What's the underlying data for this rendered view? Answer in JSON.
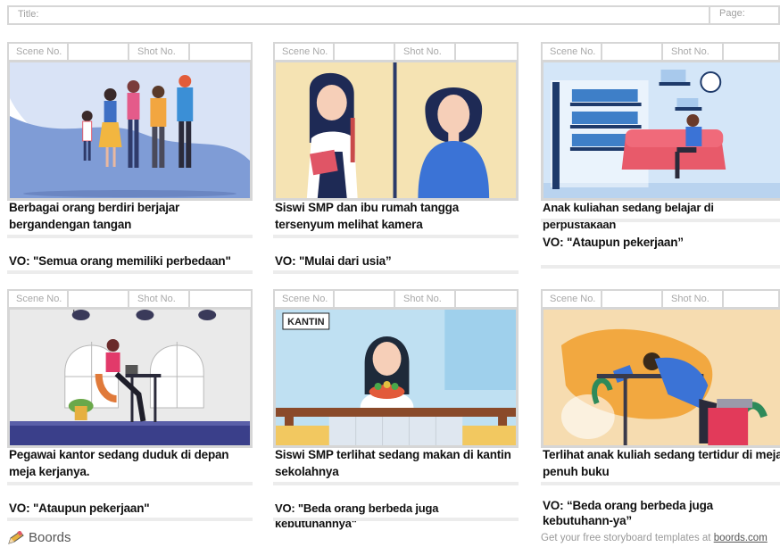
{
  "header": {
    "title_label": "Title:",
    "page_label": "Page:"
  },
  "panels": [
    {
      "scene_label": "Scene No.",
      "shot_label": "Shot No.",
      "description": "Berbagai orang berdiri berjajar bergandengan tangan",
      "vo": "VO: \"Semua orang memiliki perbedaan\""
    },
    {
      "scene_label": "Scene No.",
      "shot_label": "Shot No.",
      "description": "Siswi SMP dan ibu rumah tangga tersenyum melihat kamera",
      "vo": "VO: \"Mulai dari usia”"
    },
    {
      "scene_label": "Scene No.",
      "shot_label": "Shot No.",
      "description": "Anak kuliahan sedang belajar di perpustakaan",
      "vo": "VO: \"Ataupun pekerjaan”"
    },
    {
      "scene_label": "Scene No.",
      "shot_label": "Shot No.",
      "description": "Pegawai kantor sedang duduk di depan meja kerjanya.",
      "vo": "VO: \"Ataupun pekerjaan\""
    },
    {
      "scene_label": "Scene No.",
      "shot_label": "Shot No.",
      "description": "Siswi SMP terlihat sedang makan di kantin sekolahnya",
      "vo": "VO: \"Beda orang berbeda juga kebutuhannya\"",
      "sign_text": "KANTIN"
    },
    {
      "scene_label": "Scene No.",
      "shot_label": "Shot No.",
      "description": "Terlihat anak kuliah sedang tertidur di meja penuh buku",
      "vo": "VO: “Beda orang berbeda juga kebutuhann-ya”"
    }
  ],
  "footer": {
    "brand": "Boords",
    "note": "Get your free storyboard templates at ",
    "link": "boords.com"
  }
}
